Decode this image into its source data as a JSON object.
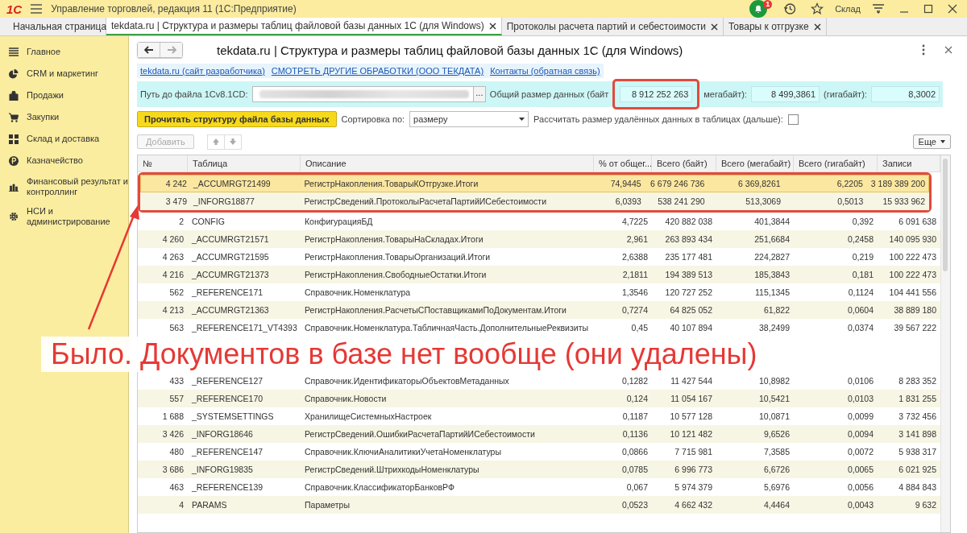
{
  "window": {
    "logo": "1С",
    "title": "Управление торговлей, редакция 11  (1С:Предприятие)",
    "notification_count": "1",
    "user": "Склад"
  },
  "tabs": [
    {
      "label": "Начальная страница",
      "selected": false,
      "kind": "home"
    },
    {
      "label": "tekdata.ru | Структура и размеры таблиц файловой базы данных 1С (для Windows)",
      "selected": true,
      "kind": "doc"
    },
    {
      "label": "Протоколы расчета партий и себестоимости",
      "selected": false,
      "kind": "doc"
    },
    {
      "label": "Товары к отгрузке",
      "selected": false,
      "kind": "doc"
    }
  ],
  "sidebar": {
    "items": [
      {
        "label": "Главное"
      },
      {
        "label": "CRM и маркетинг"
      },
      {
        "label": "Продажи"
      },
      {
        "label": "Закупки"
      },
      {
        "label": "Склад и доставка"
      },
      {
        "label": "Казначейство"
      },
      {
        "label": "Финансовый результат и контроллинг"
      },
      {
        "label": "НСИ и администрирование"
      }
    ]
  },
  "form": {
    "title": "tekdata.ru | Структура и размеры таблиц файловой базы данных 1С (для Windows)",
    "links": [
      "tekdata.ru (сайт разработчика)",
      "СМОТРЕТЬ ДРУГИЕ ОБРАБОТКИ (ООО ТЕКДАТА)",
      "Контакты (обратная связь)"
    ],
    "path_label": "Путь до файла 1Cv8.1CD:",
    "path_button": "...",
    "size": {
      "label": "Общий размер данных (байт",
      "bytes": {
        "value": "8 912 252 263",
        "circled": true
      },
      "mb_label": "мегабайт):",
      "mb": "8 499,3861",
      "gb_label": "(гигабайт):",
      "gb": "8,3002"
    },
    "read_button": "Прочитать структуру файла базы данных",
    "sort_label": "Сортировка по:",
    "sort_value": "размеру",
    "deleted": {
      "label": "Рассчитать размер удалённых данных в таблицах (дальше):",
      "checked": false
    },
    "add_button": {
      "label": "Добавить",
      "disabled": true
    },
    "more_button": "Еще"
  },
  "table": {
    "columns": [
      "№",
      "Таблица",
      "Описание",
      "% от общег...",
      "Всего (байт)",
      "Всего (мегабайт)",
      "Всего (гигабайт)",
      "Записи"
    ],
    "rows": [
      {
        "kind": "row",
        "selected": true,
        "circled": true,
        "cells": [
          "4 242",
          "_ACCUMRGT21499",
          "РегистрНакопления.ТоварыКОтгрузке.Итоги",
          "74,9445",
          "6 679 246 736",
          "6 369,8261",
          "6,2205",
          "3 189 389 200"
        ]
      },
      {
        "kind": "row",
        "selected": false,
        "circled": true,
        "cells": [
          "3 479",
          "_INFORG18877",
          "РегистрСведений.ПротоколыРасчетаПартийИСебестоимости",
          "6,0393",
          "538 241 290",
          "513,3069",
          "0,5013",
          "15 933 962"
        ]
      },
      {
        "kind": "row",
        "selected": false,
        "circled": false,
        "cells": [
          "2",
          "CONFIG",
          "КонфигурацияБД",
          "4,7225",
          "420 882 038",
          "401,3844",
          "0,392",
          "6 091 638"
        ]
      },
      {
        "kind": "row",
        "selected": false,
        "circled": false,
        "cells": [
          "4 260",
          "_ACCUMRGT21571",
          "РегистрНакопления.ТоварыНаСкладах.Итоги",
          "2,961",
          "263 893 434",
          "251,6684",
          "0,2458",
          "140 095 930"
        ]
      },
      {
        "kind": "row",
        "selected": false,
        "circled": false,
        "cells": [
          "4 263",
          "_ACCUMRGT21595",
          "РегистрНакопления.ТоварыОрганизаций.Итоги",
          "2,6388",
          "235 177 481",
          "224,2827",
          "0,219",
          "100 222 473"
        ]
      },
      {
        "kind": "row",
        "selected": false,
        "circled": false,
        "cells": [
          "4 216",
          "_ACCUMRGT21373",
          "РегистрНакопления.СвободныеОстатки.Итоги",
          "2,1811",
          "194 389 513",
          "185,3843",
          "0,181",
          "100 222 473"
        ]
      },
      {
        "kind": "row",
        "selected": false,
        "circled": false,
        "cells": [
          "562",
          "_REFERENCE171",
          "Справочник.Номенклатура",
          "1,3546",
          "120 727 252",
          "115,1345",
          "0,1124",
          "104 441 556"
        ]
      },
      {
        "kind": "row",
        "selected": false,
        "circled": false,
        "cells": [
          "4 213",
          "_ACCUMRGT21363",
          "РегистрНакопления.РасчетыСПоставщикамиПоДокументам.Итоги",
          "0,7274",
          "64 825 052",
          "61,822",
          "0,0604",
          "38 889 180"
        ]
      },
      {
        "kind": "row",
        "selected": false,
        "circled": false,
        "cells": [
          "563",
          "_REFERENCE171_VT4393",
          "Справочник.Номенклатура.ТабличнаяЧасть.ДополнительныеРеквизиты",
          "0,45",
          "40 107 894",
          "38,2499",
          "0,0374",
          "39 567 222"
        ]
      },
      {
        "kind": "banner",
        "text": "Было. Документов в базе нет вообще (они удалены)"
      },
      {
        "kind": "row",
        "selected": false,
        "circled": false,
        "cells": [
          "433",
          "_REFERENCE127",
          "Справочник.ИдентификаторыОбъектовМетаданных",
          "0,1282",
          "11 427 544",
          "10,8982",
          "0,0106",
          "8 283 352"
        ]
      },
      {
        "kind": "row",
        "selected": false,
        "circled": false,
        "cells": [
          "557",
          "_REFERENCE170",
          "Справочник.Новости",
          "0,124",
          "11 054 167",
          "10,5421",
          "0,0103",
          "1 831 255"
        ]
      },
      {
        "kind": "row",
        "selected": false,
        "circled": false,
        "cells": [
          "1 688",
          "_SYSTEMSETTINGS",
          "ХранилищеСистемныхНастроек",
          "0,1187",
          "10 577 128",
          "10,0871",
          "0,0099",
          "3 732 456"
        ]
      },
      {
        "kind": "row",
        "selected": false,
        "circled": false,
        "cells": [
          "3 426",
          "_INFORG18646",
          "РегистрСведений.ОшибкиРасчетаПартийИСебестоимости",
          "0,1136",
          "10 121 482",
          "9,6526",
          "0,0094",
          "3 141 898"
        ]
      },
      {
        "kind": "row",
        "selected": false,
        "circled": false,
        "cells": [
          "480",
          "_REFERENCE147",
          "Справочник.КлючиАналитикиУчетаНоменклатуры",
          "0,0866",
          "7 715 981",
          "7,3585",
          "0,0072",
          "5 938 317"
        ]
      },
      {
        "kind": "row",
        "selected": false,
        "circled": false,
        "cells": [
          "3 686",
          "_INFORG19835",
          "РегистрСведений.ШтрихкодыНоменклатуры",
          "0,0785",
          "6 996 773",
          "6,6726",
          "0,0065",
          "6 021 925"
        ]
      },
      {
        "kind": "row",
        "selected": false,
        "circled": false,
        "cells": [
          "463",
          "_REFERENCE139",
          "Справочник.КлассификаторБанковРФ",
          "0,067",
          "5 974 379",
          "5,6976",
          "0,0056",
          "4 884 843"
        ]
      },
      {
        "kind": "row",
        "selected": false,
        "circled": false,
        "cells": [
          "4",
          "PARAMS",
          "Параметры",
          "0,0523",
          "4 662 432",
          "4,4464",
          "0,0043",
          "9 632"
        ]
      }
    ]
  }
}
